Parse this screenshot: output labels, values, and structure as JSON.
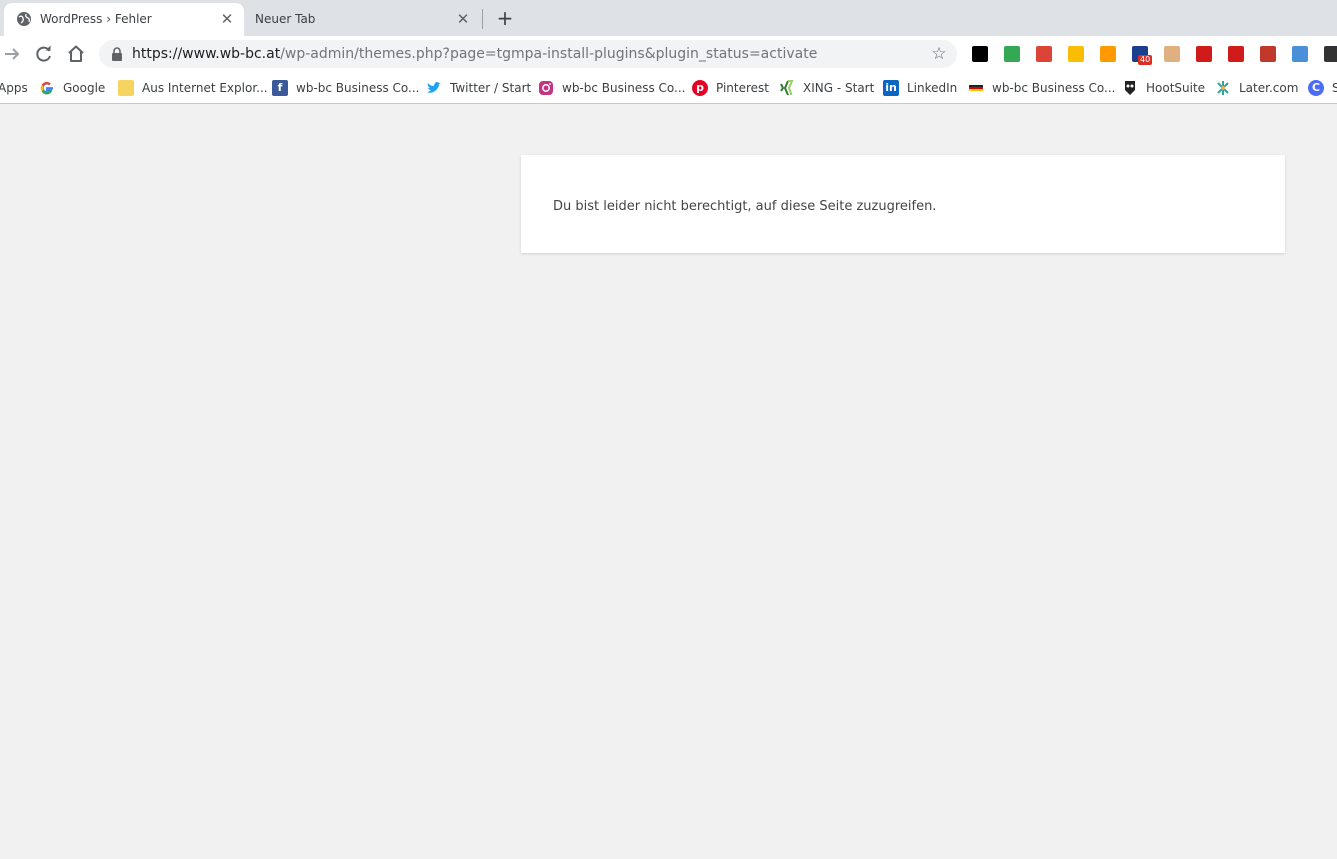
{
  "tabs": [
    {
      "title": "WordPress › Fehler",
      "active": true
    },
    {
      "title": "Neuer Tab",
      "active": false
    }
  ],
  "close_glyph": "✕",
  "new_tab_glyph": "+",
  "omnibox": {
    "host": "https://www.wb-bc.at",
    "path": "/wp-admin/themes.php?page=tgmpa-install-plugins&plugin_status=activate"
  },
  "extensions": [
    {
      "name": "hootsuite-ext-icon",
      "color": "#000000"
    },
    {
      "name": "chart-ext-icon",
      "color": "#34a853"
    },
    {
      "name": "google-plus-ext-icon",
      "color": "#db4437"
    },
    {
      "name": "drive-ext-icon",
      "color": "#fbbc04"
    },
    {
      "name": "amazon-ext-icon",
      "color": "#f90"
    },
    {
      "name": "mail-ext-icon",
      "color": "#1a3f8f",
      "badge": "40"
    },
    {
      "name": "hand-ext-icon",
      "color": "#e0b080"
    },
    {
      "name": "flash-ext-icon",
      "color": "#d11b1b"
    },
    {
      "name": "flash-red-ext-icon",
      "color": "#d11b1b"
    },
    {
      "name": "nocheck-ext-icon",
      "color": "#c0392b"
    },
    {
      "name": "booking-ext-icon",
      "color": "#4a90d9"
    },
    {
      "name": "flag-ext-icon",
      "color": "#333333"
    }
  ],
  "bookmarks": [
    {
      "label": "Apps",
      "icon": "apps-icon",
      "color": ""
    },
    {
      "label": "Google",
      "icon": "google-icon",
      "color": "#4285f4"
    },
    {
      "label": "Aus Internet Explor...",
      "icon": "folder-icon",
      "color": "#f7d460"
    },
    {
      "label": "wb-bc Business Co...",
      "icon": "facebook-icon",
      "color": "#3b5998"
    },
    {
      "label": "Twitter / Start",
      "icon": "twitter-icon",
      "color": "#1da1f2"
    },
    {
      "label": "wb-bc Business Co...",
      "icon": "instagram-icon",
      "color": "#c13584"
    },
    {
      "label": "Pinterest",
      "icon": "pinterest-icon",
      "color": "#e60023"
    },
    {
      "label": "XING - Start",
      "icon": "xing-icon",
      "color": "#7cb342"
    },
    {
      "label": "LinkedIn",
      "icon": "linkedin-icon",
      "color": "#0a66c2"
    },
    {
      "label": "wb-bc Business Co...",
      "icon": "germany-flag-icon",
      "color": "#222222"
    },
    {
      "label": "HootSuite",
      "icon": "hootsuite-icon",
      "color": "#222222"
    },
    {
      "label": "Later.com",
      "icon": "later-icon",
      "color": "#2ea3a0"
    },
    {
      "label": "S",
      "icon": "c-logo-icon",
      "color": "#4a6cf7"
    }
  ],
  "message": "Du bist leider nicht berechtigt, auf diese Seite zuzugreifen."
}
